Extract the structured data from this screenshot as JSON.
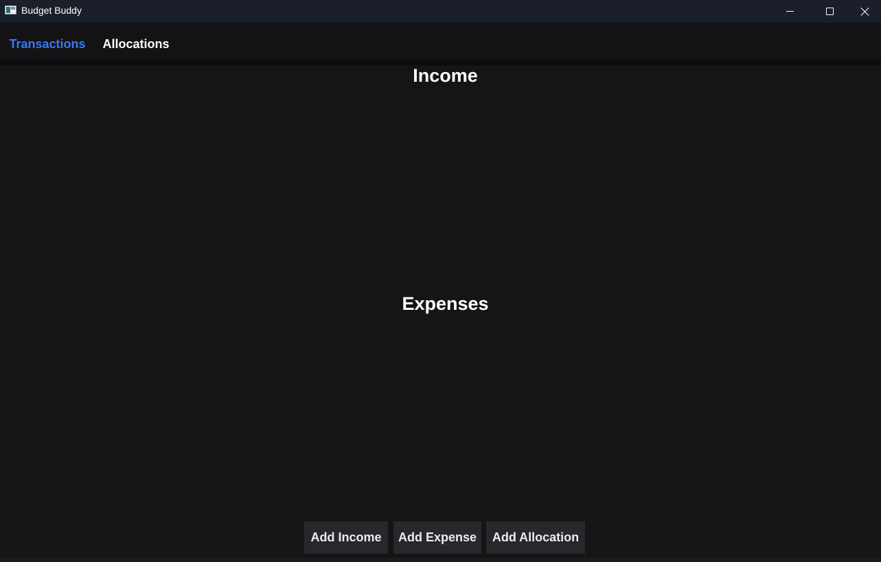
{
  "window": {
    "title": "Budget Buddy"
  },
  "tabs": [
    {
      "label": "Transactions",
      "active": true
    },
    {
      "label": "Allocations",
      "active": false
    }
  ],
  "sections": {
    "income_title": "Income",
    "expenses_title": "Expenses"
  },
  "actions": {
    "add_income": "Add Income",
    "add_expense": "Add Expense",
    "add_allocation": "Add Allocation"
  },
  "colors": {
    "accent": "#2f6df0",
    "background": "#151516",
    "titlebar": "#1b1f2a",
    "button_bg": "#27282c"
  }
}
